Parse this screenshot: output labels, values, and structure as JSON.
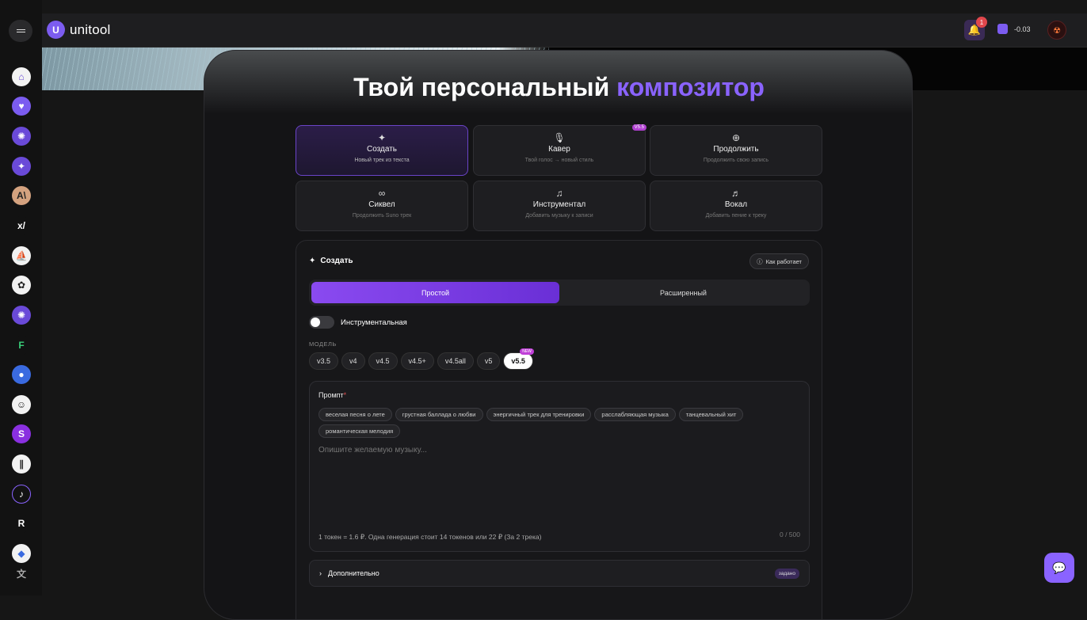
{
  "brand": {
    "name": "unitool",
    "logo_glyph": "U"
  },
  "topbar": {
    "notifications_count": "1",
    "balance": "-0.03",
    "avatar_glyph": "☢"
  },
  "hero": {
    "title_main": "Твой персональный ",
    "title_accent": "композитор"
  },
  "sidebar_icons": [
    {
      "name": "home-icon",
      "glyph": "⌂",
      "bg": "#f2f2f2",
      "fg": "#6a4ad8"
    },
    {
      "name": "heart-icon",
      "glyph": "♥",
      "bg": "#7b5cf0",
      "fg": "#fff"
    },
    {
      "name": "openai-icon",
      "glyph": "✺",
      "bg": "#6a4ad8",
      "fg": "#fff"
    },
    {
      "name": "sparkle-icon",
      "glyph": "✦",
      "bg": "#6a4ad8",
      "fg": "#fff"
    },
    {
      "name": "anthropic-icon",
      "glyph": "A\\",
      "bg": "#d4a27f",
      "fg": "#222"
    },
    {
      "name": "grok-icon",
      "glyph": "x/",
      "bg": "#121212",
      "fg": "#fff"
    },
    {
      "name": "sail-icon",
      "glyph": "⛵",
      "bg": "#f2f2f2",
      "fg": "#222"
    },
    {
      "name": "aperture-icon",
      "glyph": "✿",
      "bg": "#f2f2f2",
      "fg": "#222"
    },
    {
      "name": "openai-alt-icon",
      "glyph": "✺",
      "bg": "#6a4ad8",
      "fg": "#fff"
    },
    {
      "name": "flux-icon",
      "glyph": "F",
      "bg": "#121212",
      "fg": "#3ad07a"
    },
    {
      "name": "palette-icon",
      "glyph": "●",
      "bg": "#3a6ae0",
      "fg": "#fff"
    },
    {
      "name": "face-icon",
      "glyph": "☺",
      "bg": "#f2f2f2",
      "fg": "#222"
    },
    {
      "name": "s-dot-icon",
      "glyph": "S",
      "bg": "#8a30e0",
      "fg": "#fff"
    },
    {
      "name": "pause-icon",
      "glyph": "∥",
      "bg": "#f2f2f2",
      "fg": "#222"
    },
    {
      "name": "suno-icon",
      "glyph": "♪",
      "bg": "#121212",
      "fg": "#fff"
    },
    {
      "name": "r-icon",
      "glyph": "R",
      "bg": "#121212",
      "fg": "#fff"
    },
    {
      "name": "cube-icon",
      "glyph": "◆",
      "bg": "#f2f2f2",
      "fg": "#3a6ae0"
    },
    {
      "name": "translate-icon",
      "glyph": "文",
      "bg": "#121212",
      "fg": "#aaa"
    }
  ],
  "modes": [
    {
      "name": "mode-create",
      "icon": "✦",
      "title": "Создать",
      "sub": "Новый трек из текста",
      "active": true,
      "badge": ""
    },
    {
      "name": "mode-cover",
      "icon": "🎙",
      "title": "Кавер",
      "sub": "Твой голос → новый стиль",
      "active": false,
      "badge": "V5.5"
    },
    {
      "name": "mode-continue",
      "icon": "⊕",
      "title": "Продолжить",
      "sub": "Продолжить свою запись",
      "active": false,
      "badge": ""
    },
    {
      "name": "mode-sequel",
      "icon": "∞",
      "title": "Сиквел",
      "sub": "Продолжить Suno трек",
      "active": false,
      "badge": ""
    },
    {
      "name": "mode-instrumental",
      "icon": "♫",
      "title": "Инструментал",
      "sub": "Добавить музыку к записи",
      "active": false,
      "badge": ""
    },
    {
      "name": "mode-vocal",
      "icon": "♬",
      "title": "Вокал",
      "sub": "Добавить пение к треку",
      "active": false,
      "badge": ""
    }
  ],
  "create": {
    "heading": "Создать",
    "how_label": "Как работает",
    "tab_simple": "Простой",
    "tab_advanced": "Расширенный",
    "toggle_label": "Инструментальная",
    "model_label": "МОДЕЛЬ",
    "models": [
      "v3.5",
      "v4",
      "v4.5",
      "v4.5+",
      "v4.5all",
      "v5",
      "v5.5"
    ],
    "active_model": "v5.5",
    "new_badge": "NEW",
    "prompt_label": "Промпт",
    "prompt_required": "*",
    "chips": [
      "веселая песня о лете",
      "грустная баллада о любви",
      "энергичный трек для тренировки",
      "расслабляющая музыка",
      "танцевальный хит",
      "романтическая мелодия"
    ],
    "prompt_placeholder": "Опишите желаемую музыку...",
    "counter": "0 / 500",
    "token_note": "1 токен = 1.6 ₽. Одна генерация стоит 14 токенов или 22 ₽ (За 2 трека)",
    "extra_label": "Дополнительно",
    "extra_badge": "задано"
  },
  "colors": {
    "accent": "#8a63ff",
    "bg": "#161616"
  }
}
